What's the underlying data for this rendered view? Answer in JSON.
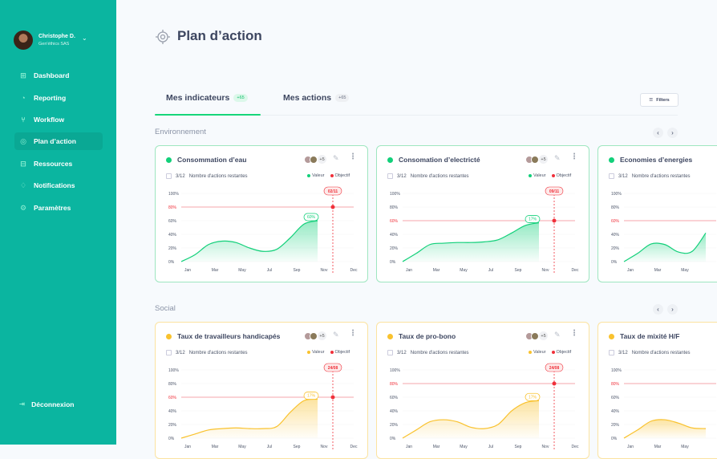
{
  "user": {
    "name": "Christophe D.",
    "company": "Gen'éthics SAS"
  },
  "sidebar": {
    "items": [
      {
        "label": "Dashboard",
        "icon": "grid-icon"
      },
      {
        "label": "Reporting",
        "icon": "chart-pie-icon"
      },
      {
        "label": "Workflow",
        "icon": "workflow-icon"
      },
      {
        "label": "Plan d’action",
        "icon": "target-icon",
        "active": true
      },
      {
        "label": "Ressources",
        "icon": "folder-icon"
      },
      {
        "label": "Notifications",
        "icon": "bell-icon"
      },
      {
        "label": "Paramètres",
        "icon": "gear-icon"
      }
    ],
    "logout": "Déconnexion"
  },
  "page": {
    "title": "Plan d’action"
  },
  "tabs": [
    {
      "label": "Mes indicateurs",
      "badge": "+65",
      "active": true
    },
    {
      "label": "Mes actions",
      "badge": "+65"
    }
  ],
  "filters_label": "Filters",
  "colors": {
    "sidebar": "#0bb5a0",
    "green": "#12d07a",
    "yellow": "#f9c22e",
    "objective": "#f0303a"
  },
  "sections": [
    {
      "label": "Environnement",
      "cards": [
        {
          "title": "Consommation d’eau",
          "more": "+5",
          "remaining": "3/12",
          "remaining_label": "Nombre d'actions restantes",
          "legend_value": "Valeur",
          "legend_objective": "Objectif",
          "color": "green",
          "value_label": "60%",
          "objective": 80,
          "objective_date": "02/11",
          "values": [
            0,
            10,
            25,
            30,
            28,
            20,
            15,
            18,
            35,
            55,
            60
          ]
        },
        {
          "title": "Consomation d’electricté",
          "more": "+5",
          "remaining": "3/12",
          "remaining_label": "Nombre d'actions restantes",
          "legend_value": "Valeur",
          "legend_objective": "Objectif",
          "color": "green",
          "value_label": "17%",
          "objective": 60,
          "objective_date": "09/11",
          "values": [
            0,
            12,
            25,
            27,
            28,
            28,
            29,
            32,
            42,
            53,
            57
          ]
        },
        {
          "title": "Economies d’energies",
          "remaining": "3/12",
          "remaining_label": "Nombre d'actions restantes",
          "color": "green",
          "objective": 60,
          "values": [
            0,
            12,
            26,
            25,
            14,
            15,
            42
          ]
        }
      ]
    },
    {
      "label": "Social",
      "cards": [
        {
          "title": "Taux de travailleurs handicapés",
          "more": "+5",
          "remaining": "3/12",
          "remaining_label": "Nombre d'actions restantes",
          "legend_value": "Valeur",
          "legend_objective": "Objectif",
          "color": "yellow",
          "value_label": "17%",
          "objective": 60,
          "objective_date": "24/08",
          "values": [
            0,
            6,
            12,
            14,
            15,
            14,
            14,
            17,
            38,
            55,
            57
          ]
        },
        {
          "title": "Taux de pro-bono",
          "more": "+5",
          "remaining": "3/12",
          "remaining_label": "Nombre d'actions restantes",
          "legend_value": "Valeur",
          "legend_objective": "Objectif",
          "color": "yellow",
          "value_label": "17%",
          "objective": 80,
          "objective_date": "24/08",
          "values": [
            0,
            12,
            24,
            27,
            24,
            16,
            14,
            20,
            40,
            52,
            55
          ]
        },
        {
          "title": "Taux de mixité H/F",
          "remaining": "3/12",
          "remaining_label": "Nombre d'actions restantes",
          "color": "yellow",
          "objective": 80,
          "values": [
            0,
            12,
            25,
            27,
            22,
            15,
            14
          ]
        }
      ]
    }
  ],
  "chart_axis": {
    "y_ticks": [
      "0%",
      "20%",
      "40%",
      "60%",
      "80%",
      "100%"
    ],
    "x_ticks": [
      "Jan",
      "Mar",
      "May",
      "Jul",
      "Sep",
      "Nov",
      "Dec"
    ],
    "ylim": [
      0,
      100
    ]
  }
}
